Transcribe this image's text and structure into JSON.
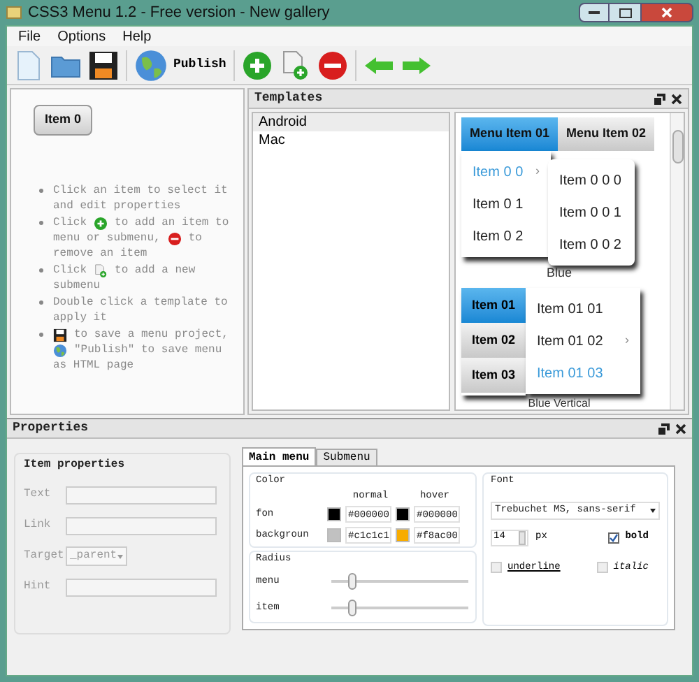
{
  "window": {
    "title": "CSS3 Menu 1.2 - Free version - New gallery"
  },
  "menu": [
    "File",
    "Options",
    "Help"
  ],
  "toolbar": [
    {
      "kind": "new"
    },
    {
      "kind": "open"
    },
    {
      "kind": "save"
    },
    {
      "kind": "sep"
    },
    {
      "kind": "publish",
      "label": "Publish"
    },
    {
      "kind": "sep"
    },
    {
      "kind": "add"
    },
    {
      "kind": "addsub"
    },
    {
      "kind": "remove"
    },
    {
      "kind": "sep"
    },
    {
      "kind": "left"
    },
    {
      "kind": "right"
    }
  ],
  "canvas": {
    "item": "Item 0",
    "hints": [
      [
        [
          {
            "kind": "text",
            "text": "Click an item to select it"
          }
        ],
        [
          {
            "kind": "text",
            "text": "and edit properties"
          }
        ]
      ],
      [
        [
          {
            "kind": "text",
            "text": "Click"
          },
          {
            "kind": "add"
          },
          {
            "kind": "text",
            "text": "to add an item to"
          }
        ],
        [
          {
            "kind": "text",
            "text": "menu or submenu,"
          },
          {
            "kind": "remove"
          },
          {
            "kind": "text",
            "text": "to"
          }
        ],
        [
          {
            "kind": "text",
            "text": "remove an item"
          }
        ]
      ],
      [
        [
          {
            "kind": "text",
            "text": "Click"
          },
          {
            "kind": "addsub"
          },
          {
            "kind": "text",
            "text": "to add a new"
          }
        ],
        [
          {
            "kind": "text",
            "text": "submenu"
          }
        ]
      ],
      [
        [
          {
            "kind": "text",
            "text": "Double click a template to"
          }
        ],
        [
          {
            "kind": "text",
            "text": "apply it"
          }
        ]
      ],
      [
        [
          {
            "kind": "save"
          },
          {
            "kind": "text",
            "text": "to save a menu project,"
          }
        ],
        [
          {
            "kind": "globe"
          },
          {
            "kind": "text",
            "text": "\"Publish\" to save menu"
          }
        ],
        [
          {
            "kind": "text",
            "text": "as HTML page"
          }
        ]
      ]
    ]
  },
  "templates": {
    "title": "Templates",
    "items": [
      {
        "label": "Android",
        "selected": true
      },
      {
        "label": "Mac",
        "selected": false
      }
    ]
  },
  "preview": {
    "horizontal": {
      "items": [
        {
          "label": "Menu Item 01",
          "selected": true
        },
        {
          "label": "Menu Item 02",
          "selected": false
        }
      ],
      "dropdown": [
        {
          "label": "Item 0 0",
          "selected": true,
          "arrow": "›"
        },
        {
          "label": "Item 0 1",
          "selected": false
        },
        {
          "label": "Item 0 2",
          "selected": false
        }
      ],
      "submenu": [
        {
          "label": "Item 0 0 0",
          "selected": false
        },
        {
          "label": "Item 0 0 1",
          "selected": false
        },
        {
          "label": "Item 0 0 2",
          "selected": false
        }
      ],
      "caption": "Blue"
    },
    "vertical": {
      "items": [
        {
          "label": "Item 01",
          "selected": true
        },
        {
          "label": "Item 02",
          "selected": false
        },
        {
          "label": "Item 03",
          "selected": false
        }
      ],
      "submenu": [
        {
          "label": "Item 01 01",
          "selected": false
        },
        {
          "label": "Item 01 02",
          "selected": false,
          "arrow": "›"
        },
        {
          "label": "Item 01 03",
          "selected": true
        }
      ],
      "caption": "Blue Vertical"
    }
  },
  "properties": {
    "title": "Properties",
    "item_properties": {
      "title": "Item properties",
      "fields": [
        {
          "kind": "input",
          "label": "Text"
        },
        {
          "kind": "input",
          "label": "Link"
        },
        {
          "kind": "select",
          "label": "Target",
          "value": "_parent"
        },
        {
          "kind": "input",
          "label": "Hint"
        }
      ]
    },
    "tabs": [
      {
        "label": "Main menu",
        "selected": true
      },
      {
        "label": "Submenu",
        "selected": false
      }
    ],
    "color": {
      "title": "Color",
      "headers": [
        "normal",
        "hover"
      ],
      "rows": [
        {
          "label": "fon",
          "normal": {
            "color": "#000000",
            "value": "#000000"
          },
          "hover": {
            "color": "#000000",
            "value": "#000000"
          }
        },
        {
          "label": "backgroun",
          "normal": {
            "color": "#c1c1c1",
            "value": "#c1c1c1"
          },
          "hover": {
            "color": "#f8ac00",
            "value": "#f8ac00"
          }
        }
      ]
    },
    "radius": {
      "title": "Radius",
      "sliders": [
        {
          "label": "menu",
          "level": 0.13
        },
        {
          "label": "item",
          "level": 0.13
        }
      ]
    },
    "font": {
      "title": "Font",
      "family": "Trebuchet MS, sans-serif",
      "size": "14",
      "unit": "px",
      "options": [
        {
          "label": "bold",
          "checked": true
        },
        {
          "label": "underline",
          "checked": false
        },
        {
          "label": "italic",
          "checked": false
        }
      ]
    }
  }
}
